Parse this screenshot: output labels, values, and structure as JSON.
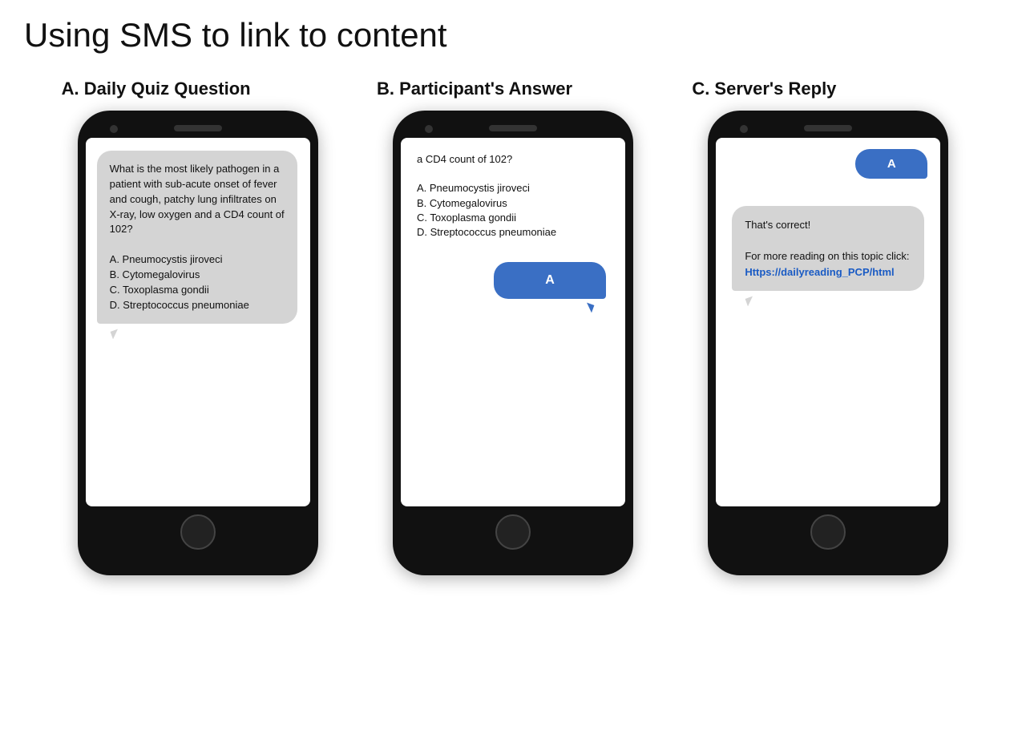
{
  "page": {
    "title": "Using SMS to link to content"
  },
  "sections": [
    {
      "label": "A.   Daily Quiz Question",
      "phone": {
        "bubble_type": "left",
        "content": "What is the most likely pathogen in a patient with sub-acute onset of fever and cough, patchy lung infiltrates on X-ray, low oxygen and a CD4 count of 102?\n\nA.   Pneumocystis jiroveci\nB.   Cytomegalovirus\nC.   Toxoplasma gondii\nD.   Streptococcus pneumoniae"
      }
    },
    {
      "label": "B. Participant's Answer",
      "phone": {
        "partial_top": "a CD4 count of 102?\n\nA.   Pneumocystis jiroveci\nB.   Cytomegalovirus\nC.   Toxoplasma gondii\nD.   Streptococcus pneumoniae",
        "bubble_right_text": "A"
      }
    },
    {
      "label": "C. Server's Reply",
      "phone": {
        "bubble_right_top": "A",
        "bubble_left_text": "That's correct!\n\nFor more reading on this topic click:",
        "link_text": "Https://dailyreading_PCP/html"
      }
    }
  ]
}
